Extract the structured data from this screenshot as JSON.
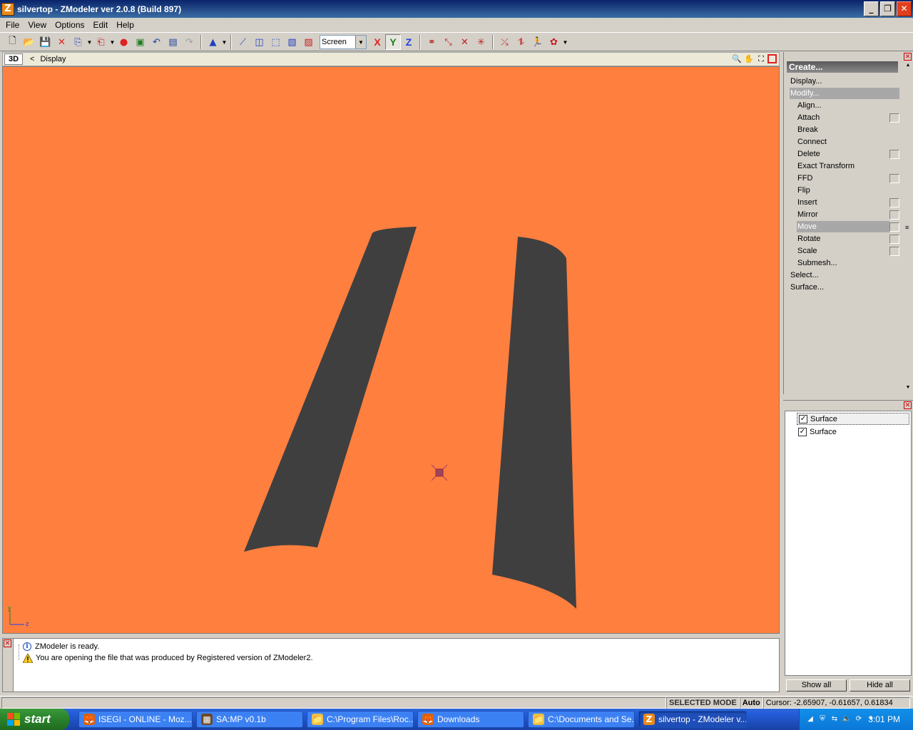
{
  "window": {
    "title": "silvertop - ZModeler ver 2.0.8 (Build 897)",
    "app_icon_letter": "Z"
  },
  "menu": [
    "File",
    "View",
    "Options",
    "Edit",
    "Help"
  ],
  "toolbar": {
    "coord_system": "Screen",
    "axes": {
      "x": "X",
      "y": "Y",
      "z": "Z"
    },
    "active_axis": "y"
  },
  "viewport": {
    "mode": "3D",
    "back": "<",
    "title": "Display",
    "background_color": "#ff7f3f",
    "mesh_color": "#3f3f3f",
    "axis_labels": {
      "y": "y",
      "z": "z"
    }
  },
  "command_panel": {
    "header": "Create...",
    "items": [
      {
        "label": "Display...",
        "level": 0
      },
      {
        "label": "Modify...",
        "level": 0,
        "highlighted": true
      },
      {
        "label": "Align...",
        "level": 1
      },
      {
        "label": "Attach",
        "level": 1,
        "checkbox": true
      },
      {
        "label": "Break",
        "level": 1
      },
      {
        "label": "Connect",
        "level": 1
      },
      {
        "label": "Delete",
        "level": 1,
        "checkbox": true
      },
      {
        "label": "Exact Transform",
        "level": 1
      },
      {
        "label": "FFD",
        "level": 1,
        "checkbox": true
      },
      {
        "label": "Flip",
        "level": 1
      },
      {
        "label": "Insert",
        "level": 1,
        "checkbox": true
      },
      {
        "label": "Mirror",
        "level": 1,
        "checkbox": true
      },
      {
        "label": "Move",
        "level": 1,
        "checkbox": true,
        "selected": true
      },
      {
        "label": "Rotate",
        "level": 1,
        "checkbox": true
      },
      {
        "label": "Scale",
        "level": 1,
        "checkbox": true
      },
      {
        "label": "Submesh...",
        "level": 1
      },
      {
        "label": "Select...",
        "level": 0
      },
      {
        "label": "Surface...",
        "level": 0
      }
    ]
  },
  "object_list": {
    "items": [
      {
        "label": "Surface",
        "checked": true,
        "focused": true
      },
      {
        "label": "Surface",
        "checked": true,
        "focused": false
      }
    ],
    "show_all": "Show all",
    "hide_all": "Hide all"
  },
  "log": [
    {
      "type": "info",
      "text": "ZModeler is ready."
    },
    {
      "type": "warning",
      "text": "You are opening the file that was produced by Registered version of ZModeler2."
    }
  ],
  "status": {
    "mode": "SELECTED MODE",
    "auto": "Auto",
    "cursor": "Cursor: -2.65907, -0.61657, 0.61834"
  },
  "taskbar": {
    "start": "start",
    "tasks": [
      {
        "label": "ISEGI - ONLINE - Moz...",
        "icon": "firefox-icon"
      },
      {
        "label": "SA:MP v0.1b",
        "icon": "samp-icon"
      },
      {
        "label": "C:\\Program Files\\Roc...",
        "icon": "folder-icon"
      },
      {
        "label": "Downloads",
        "icon": "firefox-icon"
      },
      {
        "label": "C:\\Documents and Se...",
        "icon": "folder-icon"
      },
      {
        "label": "silvertop - ZModeler v...",
        "icon": "zmodeler-icon",
        "active": true
      }
    ],
    "clock": "3:01 PM"
  }
}
